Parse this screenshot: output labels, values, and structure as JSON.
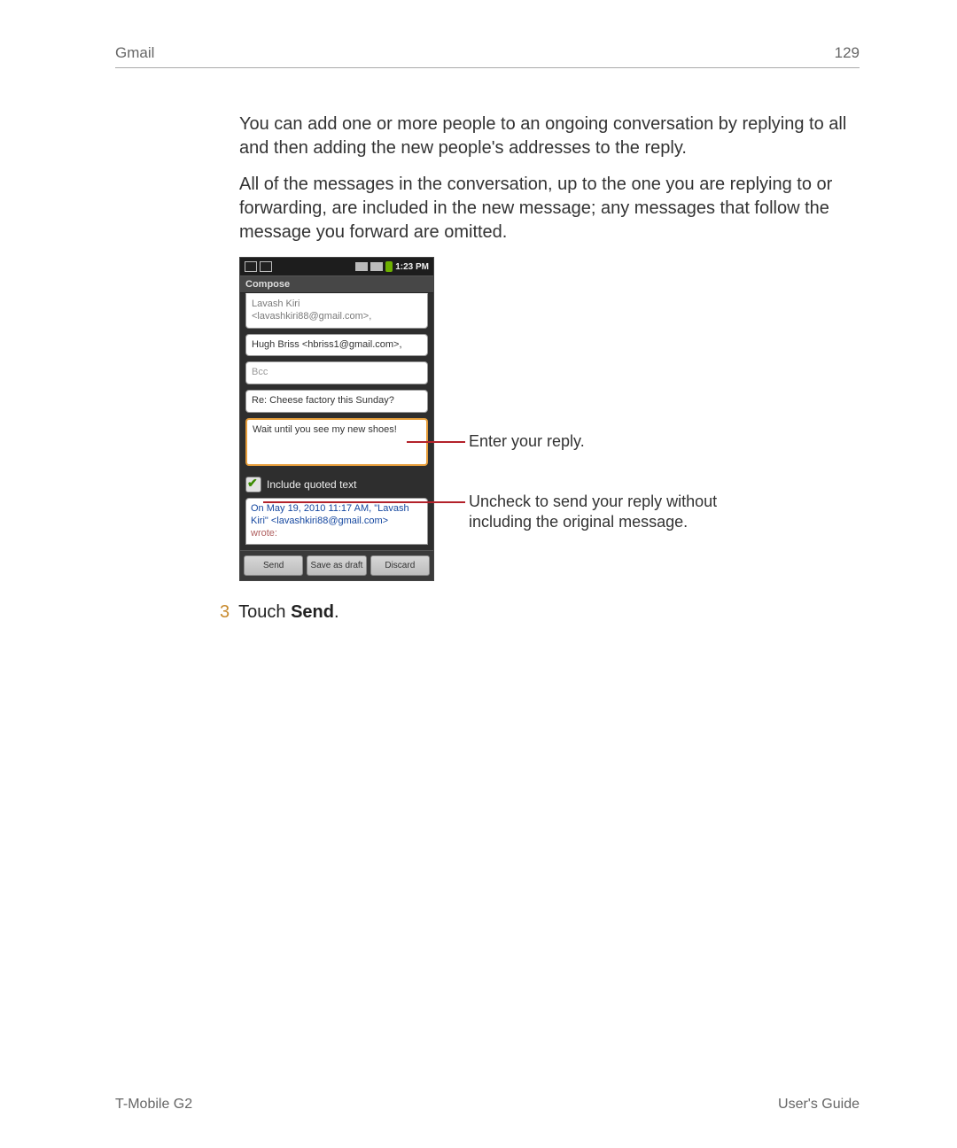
{
  "header": {
    "section": "Gmail",
    "page_number": "129"
  },
  "body": {
    "para1": "You can add one or more people to an ongoing conversation by replying to all and then adding the new people's addresses to the reply.",
    "para2": "All of the messages in the conversation, up to the one you are replying to or forwarding, are included in the new message; any messages that follow the message you forward are omitted."
  },
  "phone": {
    "statusbar": {
      "time": "1:23 PM"
    },
    "compose_title": "Compose",
    "from_field": "Lavash Kiri <lavashkiri88@gmail.com>,",
    "to_field": "Hugh Briss <hbriss1@gmail.com>,",
    "bcc_placeholder": "Bcc",
    "subject": "Re: Cheese factory this Sunday?",
    "reply_body": "Wait until you see my new shoes!",
    "quoted_label": "Include quoted text",
    "quoted_text_line1": "On May 19, 2010 11:17 AM, \"Lavash Kiri\" <lavashkiri88@gmail.com>",
    "quoted_text_wrote": "wrote:",
    "buttons": {
      "send": "Send",
      "draft": "Save as draft",
      "discard": "Discard"
    }
  },
  "callouts": {
    "reply": "Enter your reply.",
    "uncheck": "Uncheck to send your reply without including the original message."
  },
  "step": {
    "num": "3",
    "text_prefix": "Touch ",
    "text_bold": "Send",
    "text_suffix": "."
  },
  "footer": {
    "left": "T-Mobile G2",
    "right": "User's Guide"
  }
}
